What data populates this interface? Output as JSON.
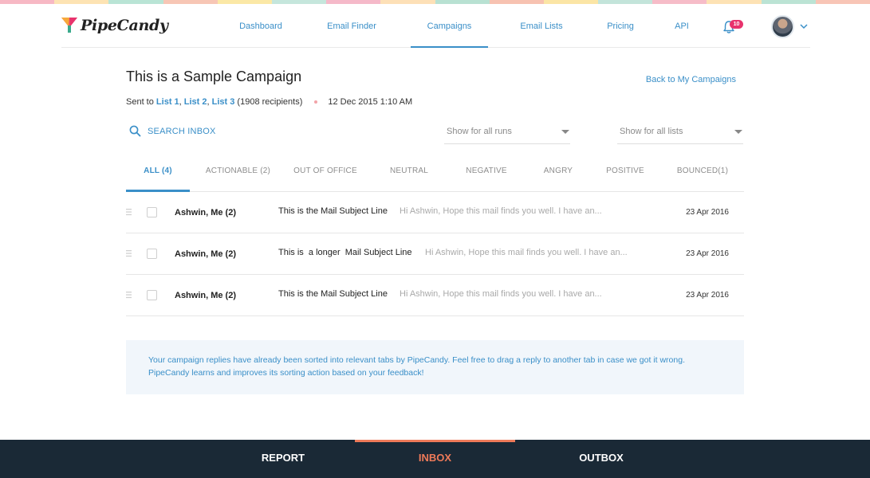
{
  "colors": {
    "accent": "#3a8fc8",
    "badge": "#e8336d",
    "bottom_bar": "#1a2936",
    "bottom_active": "#ee7a59",
    "info_bg": "#f1f6fb",
    "stripe": [
      "#f7b8c4",
      "#fde3b3",
      "#b9e4d5",
      "#f7c6b5",
      "#fbe8a6",
      "#c5e6dc",
      "#f5b9c9",
      "#fde0b7",
      "#b8e1d2",
      "#f7c2b1",
      "#fbe5a5",
      "#c3e4da",
      "#f6bcc8",
      "#fde2b4",
      "#bbe3d4",
      "#f8c5b6"
    ]
  },
  "header": {
    "logo_text": "PipeCandy",
    "nav": [
      {
        "label": "Dashboard",
        "active": false
      },
      {
        "label": "Email Finder",
        "active": false
      },
      {
        "label": "Campaigns",
        "active": true
      },
      {
        "label": "Email Lists",
        "active": false
      },
      {
        "label": "Pricing",
        "active": false
      },
      {
        "label": "API",
        "active": false
      }
    ],
    "notification_count": "10",
    "icons": {
      "bell": "bell-icon",
      "avatar": "avatar",
      "caret": "chevron-down-icon"
    }
  },
  "campaign": {
    "title": "This is a Sample Campaign",
    "back_link": "Back to My Campaigns",
    "sent_prefix": "Sent to ",
    "lists": [
      "List 1",
      "List 2",
      "List 3"
    ],
    "list_separator": ", ",
    "recipients": " (1908 recipients)",
    "sent_date": "12 Dec 2015 1:10 AM"
  },
  "filters": {
    "search_label": "SEARCH INBOX",
    "runs_select": "Show for all runs",
    "lists_select": "Show for all lists"
  },
  "tabs": [
    {
      "label": "ALL (4)",
      "active": true
    },
    {
      "label": "ACTIONABLE (2)",
      "active": false
    },
    {
      "label": "OUT OF OFFICE",
      "active": false
    },
    {
      "label": "NEUTRAL",
      "active": false
    },
    {
      "label": "NEGATIVE",
      "active": false
    },
    {
      "label": "ANGRY",
      "active": false
    },
    {
      "label": "POSITIVE",
      "active": false
    },
    {
      "label": "BOUNCED(1)",
      "active": false
    }
  ],
  "messages": [
    {
      "from": "Ashwin, Me (2)",
      "subject": "This is the Mail Subject Line",
      "preview": "Hi Ashwin, Hope this mail finds you well. I have an...",
      "date": "23 Apr 2016"
    },
    {
      "from": "Ashwin, Me (2)",
      "subject": "This is  a longer  Mail Subject Line",
      "preview": "Hi Ashwin, Hope this mail finds you well. I have an...",
      "date": "23 Apr 2016"
    },
    {
      "from": "Ashwin, Me (2)",
      "subject": "This is the Mail Subject Line",
      "preview": "Hi Ashwin, Hope this mail finds you well. I have an...",
      "date": "23 Apr 2016"
    }
  ],
  "info": {
    "line1": "Your campaign replies have already been sorted into relevant tabs by PipeCandy. Feel free to drag a reply to another tab in case we got it wrong.",
    "line2": "PipeCandy learns and improves its sorting action based on your feedback!"
  },
  "bottom_tabs": [
    {
      "label": "REPORT",
      "active": false
    },
    {
      "label": "INBOX",
      "active": true
    },
    {
      "label": "OUTBOX",
      "active": false
    }
  ]
}
